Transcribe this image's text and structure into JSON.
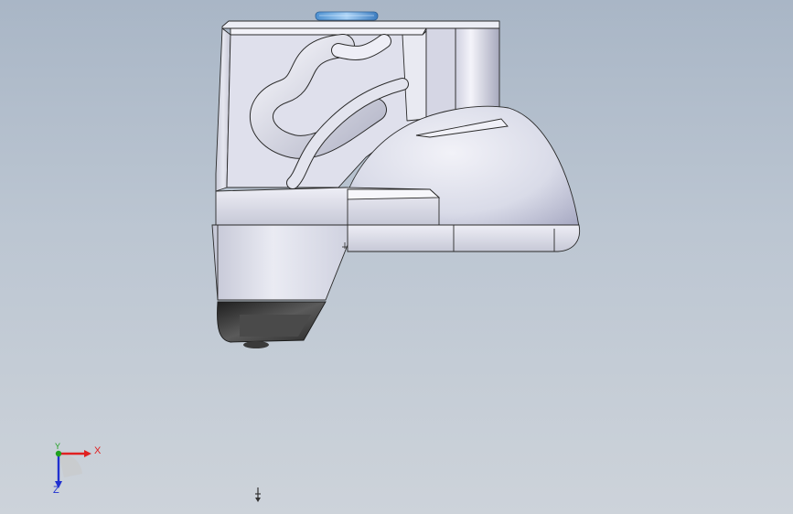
{
  "viewport": {
    "background_top": "#a9b6c6",
    "background_bottom": "#cdd3da",
    "part_color": "#dcdde8",
    "shadow_color": "#3c3c3c",
    "accent_color": "#4f93d3"
  },
  "triad": {
    "x_label": "X",
    "y_label": "Y",
    "z_label": "Z",
    "x_color": "#e02020",
    "y_color": "#20a020",
    "z_color": "#2030d0"
  },
  "icons": {
    "model": "cad-part-model",
    "triad": "coordinate-triad-icon",
    "origin": "origin-marker-icon"
  }
}
